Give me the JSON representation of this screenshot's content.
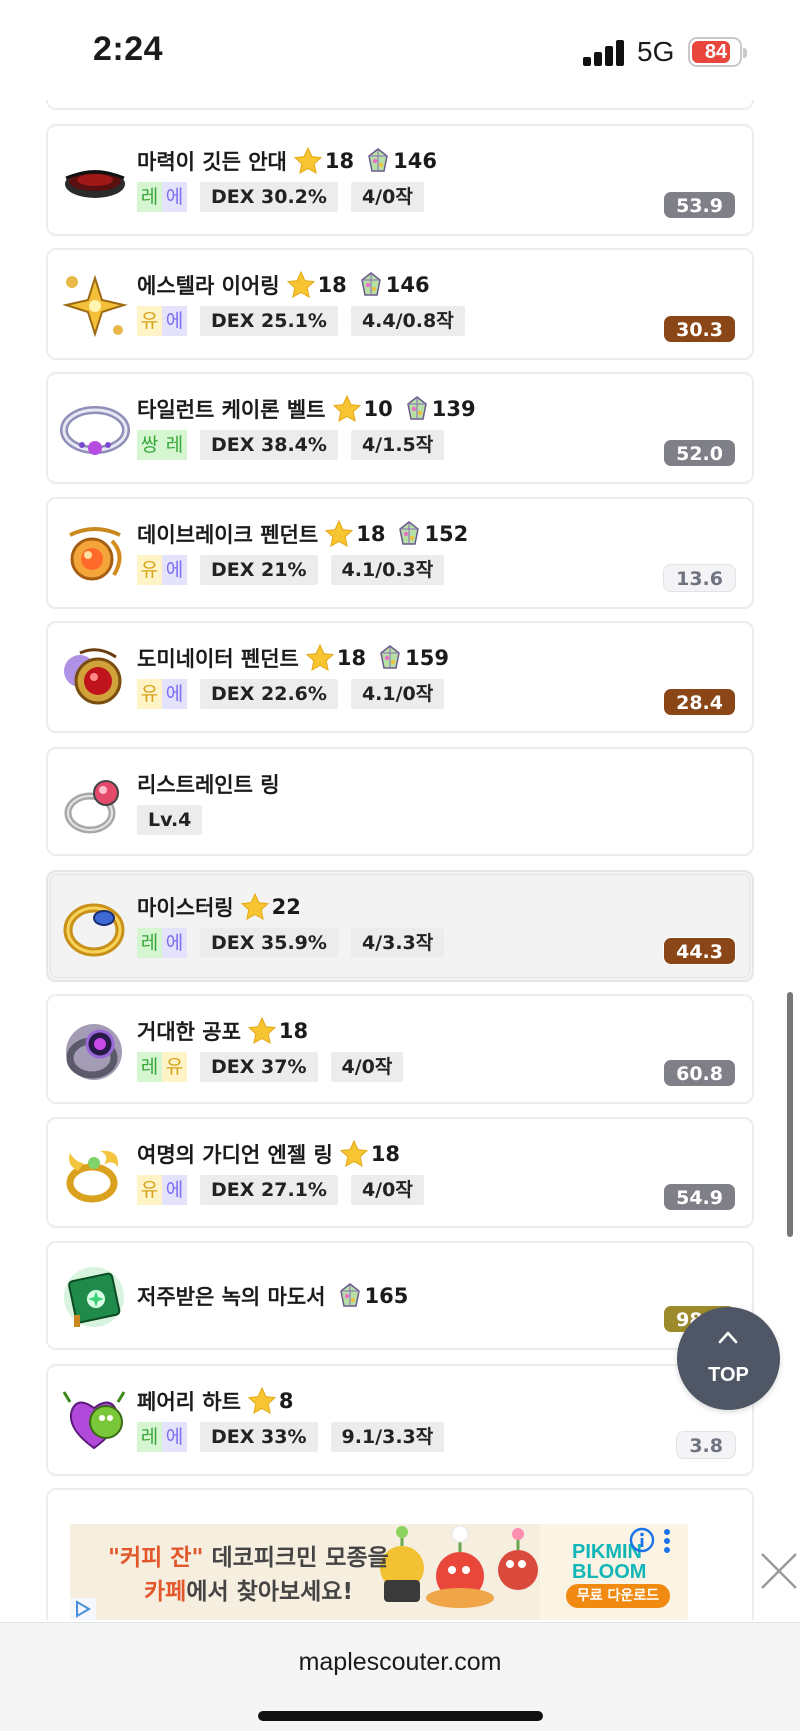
{
  "status_bar": {
    "time": "2:24",
    "network": "5G",
    "battery": "84"
  },
  "items": [
    {
      "name": "마력이 깃든 안대",
      "star": "18",
      "gem": "146",
      "grade": [
        {
          "t": "레",
          "c": "g-leg"
        },
        {
          "t": "에",
          "c": "g-epic"
        }
      ],
      "chips": [
        "DEX 30.2%",
        "4/0작"
      ],
      "score": "53.9",
      "score_style": "gray",
      "icon": "eye-patch-icon"
    },
    {
      "name": "에스텔라 이어링",
      "star": "18",
      "gem": "146",
      "grade": [
        {
          "t": "유",
          "c": "g-uni"
        },
        {
          "t": "에",
          "c": "g-epic"
        }
      ],
      "chips": [
        "DEX 25.1%",
        "4.4/0.8작"
      ],
      "score": "30.3",
      "score_style": "brown",
      "icon": "earring-icon"
    },
    {
      "name": "타일런트 케이론 벨트",
      "star": "10",
      "gem": "139",
      "grade": [
        {
          "t": "쌍",
          "c": "g-leg"
        },
        {
          "t": "레",
          "c": "g-leg"
        }
      ],
      "chips": [
        "DEX 38.4%",
        "4/1.5작"
      ],
      "score": "52.0",
      "score_style": "gray",
      "icon": "belt-icon"
    },
    {
      "name": "데이브레이크 펜던트",
      "star": "18",
      "gem": "152",
      "grade": [
        {
          "t": "유",
          "c": "g-uni"
        },
        {
          "t": "에",
          "c": "g-epic"
        }
      ],
      "chips": [
        "DEX 21%",
        "4.1/0.3작"
      ],
      "score": "13.6",
      "score_style": "light",
      "icon": "pendant-icon"
    },
    {
      "name": "도미네이터 펜던트",
      "star": "18",
      "gem": "159",
      "grade": [
        {
          "t": "유",
          "c": "g-uni"
        },
        {
          "t": "에",
          "c": "g-epic"
        }
      ],
      "chips": [
        "DEX 22.6%",
        "4.1/0작"
      ],
      "score": "28.4",
      "score_style": "brown",
      "icon": "dominator-pendant-icon"
    },
    {
      "name": "리스트레인트 링",
      "star": "",
      "gem": "",
      "grade": [],
      "chips": [
        "Lv.4"
      ],
      "score": "",
      "score_style": "",
      "icon": "ring-icon"
    },
    {
      "name": "마이스터링",
      "star": "22",
      "gem": "",
      "grade": [
        {
          "t": "레",
          "c": "g-leg"
        },
        {
          "t": "에",
          "c": "g-epic"
        }
      ],
      "chips": [
        "DEX 35.9%",
        "4/3.3작"
      ],
      "score": "44.3",
      "score_style": "brown",
      "icon": "meister-ring-icon",
      "highlight": true
    },
    {
      "name": "거대한 공포",
      "star": "18",
      "gem": "",
      "grade": [
        {
          "t": "레",
          "c": "g-leg"
        },
        {
          "t": "유",
          "c": "g-uni"
        }
      ],
      "chips": [
        "DEX 37%",
        "4/0작"
      ],
      "score": "60.8",
      "score_style": "gray",
      "icon": "dark-ring-icon"
    },
    {
      "name": "여명의 가디언 엔젤 링",
      "star": "18",
      "gem": "",
      "grade": [
        {
          "t": "유",
          "c": "g-uni"
        },
        {
          "t": "에",
          "c": "g-epic"
        }
      ],
      "chips": [
        "DEX 27.1%",
        "4/0작"
      ],
      "score": "54.9",
      "score_style": "gray",
      "icon": "angel-ring-icon"
    },
    {
      "name": "저주받은 녹의 마도서",
      "star": "",
      "gem": "165",
      "grade": [],
      "chips": [],
      "score": "98.0",
      "score_style": "olive",
      "icon": "spellbook-icon"
    },
    {
      "name": "페어리 하트",
      "star": "8",
      "gem": "",
      "grade": [
        {
          "t": "레",
          "c": "g-leg"
        },
        {
          "t": "에",
          "c": "g-epic"
        }
      ],
      "chips": [
        "DEX 33%",
        "9.1/3.3작"
      ],
      "score": "3.8",
      "score_style": "light",
      "icon": "fairy-heart-icon"
    }
  ],
  "top_button": {
    "label": "TOP"
  },
  "ad": {
    "line1_quote": "\"커피 잔\"",
    "line1_rest": " 데코피크민 모종을",
    "line2_a": "카페",
    "line2_b": "에서 찾아보세요!",
    "brand": "PIKMIN BLOOM",
    "cta": "무료 다운로드"
  },
  "url_bar": {
    "url": "maplescouter.com"
  },
  "colors": {
    "score_gray": "#7f7f88",
    "score_brown": "#8b4617",
    "top_button": "#4f5665",
    "star": "#f7c531"
  }
}
